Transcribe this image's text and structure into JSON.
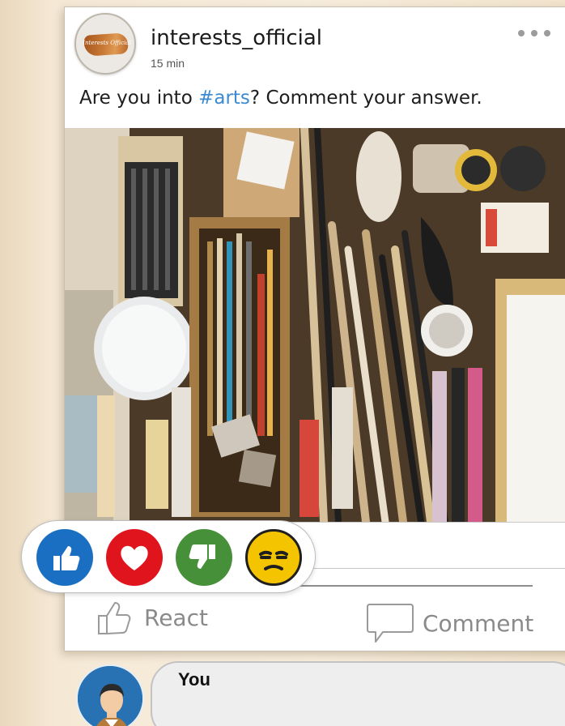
{
  "post": {
    "username": "interests_official",
    "timestamp": "15 min",
    "brand_text": "Interests Official",
    "caption_before": "Are you into ",
    "caption_hashtag": "#arts",
    "caption_after": "? Comment your answer."
  },
  "icons": {
    "more": "more-options-icon",
    "like": "thumbs-up-icon",
    "love": "heart-icon",
    "dislike": "thumbs-down-icon",
    "meh": "unamused-face-icon",
    "react": "thumbs-up-outline-icon",
    "comment": "speech-bubble-icon"
  },
  "actions": {
    "react_label": "React",
    "comment_label": "Comment"
  },
  "comment": {
    "author": "You",
    "text": ""
  },
  "colors": {
    "hashtag": "#3c8ad0",
    "like": "#1a6fc2",
    "love": "#e0141c",
    "dislike": "#47903a",
    "meh": "#f5c400"
  }
}
